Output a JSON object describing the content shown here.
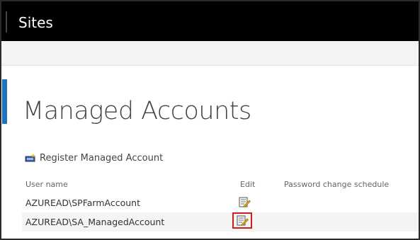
{
  "suitebar": {
    "title": "Sites"
  },
  "page": {
    "title": "Managed Accounts"
  },
  "actions": {
    "register_label": "Register Managed Account",
    "register_icon": "register-account-icon"
  },
  "table": {
    "columns": [
      "User name",
      "Edit",
      "Password change schedule"
    ],
    "rows": [
      {
        "user": "AZUREAD\\SPFarmAccount",
        "edit_icon": "edit-icon",
        "schedule": ""
      },
      {
        "user": "AZUREAD\\SA_ManagedAccount",
        "edit_icon": "edit-icon",
        "schedule": "",
        "highlighted": true
      }
    ]
  },
  "colors": {
    "suitebar_bg": "#000000",
    "accent_blue": "#1e73be",
    "highlight_red": "#d11d1d"
  }
}
